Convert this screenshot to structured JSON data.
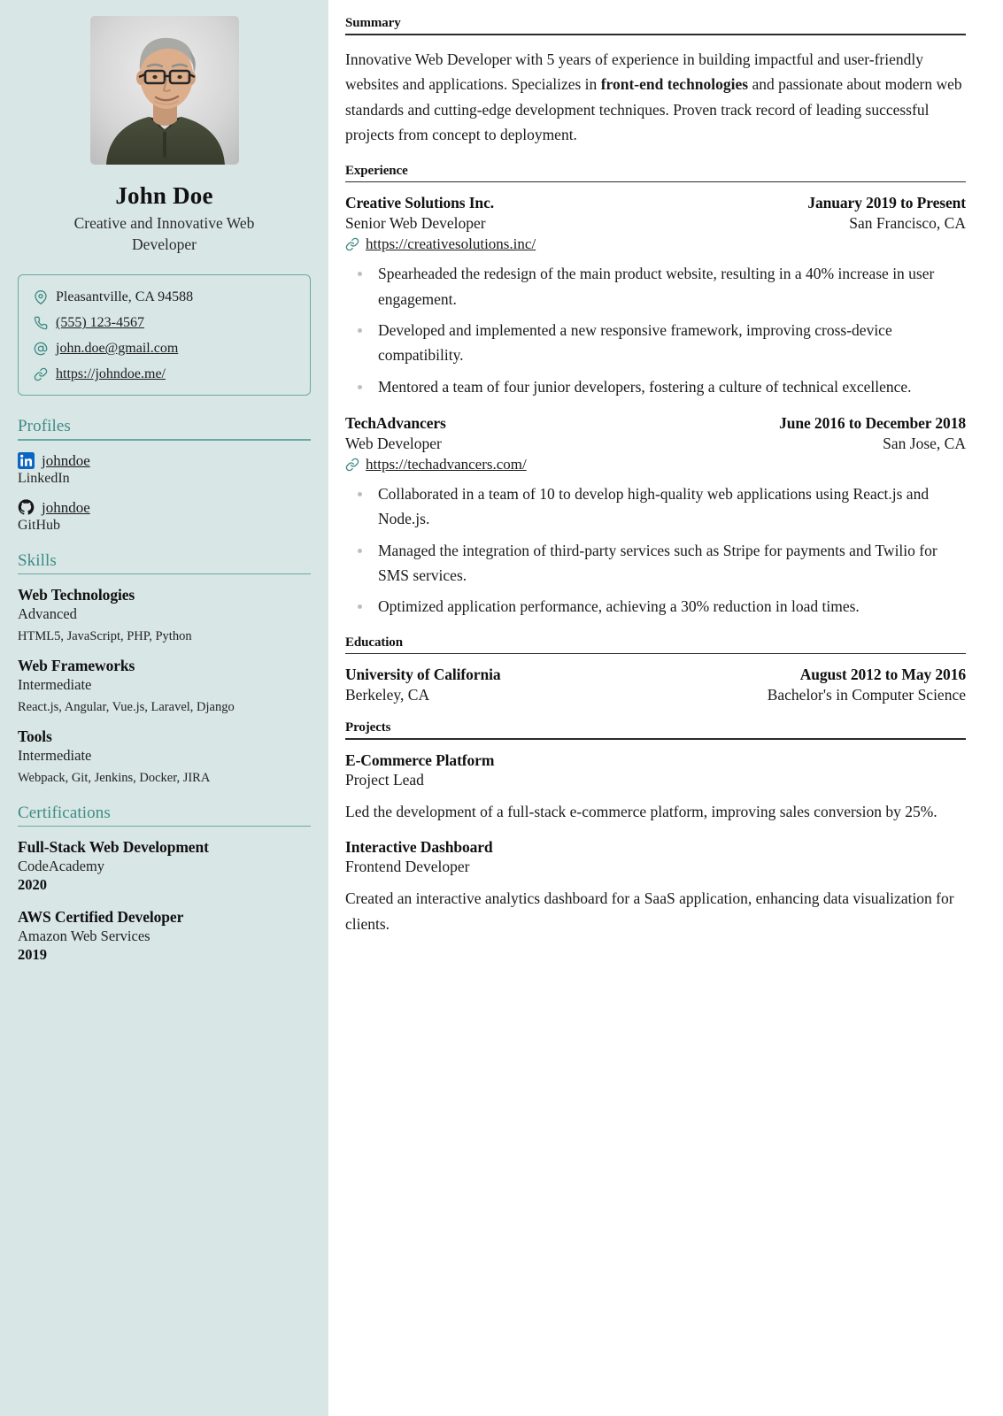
{
  "theme": {
    "sidebar_bg": "#d8e6e5",
    "accent_teal": "#3d8b85",
    "border_teal": "#6aa9a3",
    "linkedin_blue": "#0a66c2",
    "github_black": "#181717",
    "bullet_gray": "#b9bfc4",
    "text": "#1a1a1a"
  },
  "basics": {
    "name": "John Doe",
    "headline": "Creative and Innovative Web Developer",
    "photo_alt": "profile-photo"
  },
  "contact": [
    {
      "icon": "map-pin-icon",
      "label": "Pleasantville, CA 94588",
      "link": false
    },
    {
      "icon": "phone-icon",
      "label": "(555) 123-4567",
      "link": true
    },
    {
      "icon": "at-sign-icon",
      "label": "john.doe@gmail.com",
      "link": true
    },
    {
      "icon": "link-icon",
      "label": "https://johndoe.me/",
      "link": true
    }
  ],
  "sidebar": {
    "profiles": {
      "heading": "Profiles",
      "items": [
        {
          "icon": "linkedin-icon",
          "username": "johndoe",
          "network": "LinkedIn"
        },
        {
          "icon": "github-icon",
          "username": "johndoe",
          "network": "GitHub"
        }
      ]
    },
    "skills": {
      "heading": "Skills",
      "items": [
        {
          "name": "Web Technologies",
          "level": "Advanced",
          "keywords": "HTML5, JavaScript, PHP, Python"
        },
        {
          "name": "Web Frameworks",
          "level": "Intermediate",
          "keywords": "React.js, Angular, Vue.js, Laravel, Django"
        },
        {
          "name": "Tools",
          "level": "Intermediate",
          "keywords": "Webpack, Git, Jenkins, Docker, JIRA"
        }
      ]
    },
    "certifications": {
      "heading": "Certifications",
      "items": [
        {
          "name": "Full-Stack Web Development",
          "issuer": "CodeAcademy",
          "date": "2020"
        },
        {
          "name": "AWS Certified Developer",
          "issuer": "Amazon Web Services",
          "date": "2019"
        }
      ]
    }
  },
  "main": {
    "summary": {
      "heading": "Summary",
      "text_before": "Innovative Web Developer with 5 years of experience in building impactful and user-friendly websites and applications. Specializes in ",
      "text_bold": "front-end technologies",
      "text_after": " and passionate about modern web standards and cutting-edge development techniques. Proven track record of leading successful projects from concept to deployment."
    },
    "experience": {
      "heading": "Experience",
      "items": [
        {
          "organization": "Creative Solutions Inc.",
          "date": "January 2019 to Present",
          "position": "Senior Web Developer",
          "location": "San Francisco, CA",
          "url": "https://creativesolutions.inc/",
          "highlights": [
            "Spearheaded the redesign of the main product website, resulting in a 40% increase in user engagement.",
            "Developed and implemented a new responsive framework, improving cross-device compatibility.",
            "Mentored a team of four junior developers, fostering a culture of technical excellence."
          ]
        },
        {
          "organization": "TechAdvancers",
          "date": "June 2016 to December 2018",
          "position": "Web Developer",
          "location": "San Jose, CA",
          "url": "https://techadvancers.com/",
          "highlights": [
            "Collaborated in a team of 10 to develop high-quality web applications using React.js and Node.js.",
            "Managed the integration of third-party services such as Stripe for payments and Twilio for SMS services.",
            "Optimized application performance, achieving a 30% reduction in load times."
          ]
        }
      ]
    },
    "education": {
      "heading": "Education",
      "items": [
        {
          "institution": "University of California",
          "date": "August 2012 to May 2016",
          "location": "Berkeley, CA",
          "degree": "Bachelor's in Computer Science"
        }
      ]
    },
    "projects": {
      "heading": "Projects",
      "items": [
        {
          "name": "E-Commerce Platform",
          "role": "Project Lead",
          "description": "Led the development of a full-stack e-commerce platform, improving sales conversion by 25%."
        },
        {
          "name": "Interactive Dashboard",
          "role": "Frontend Developer",
          "description": "Created an interactive analytics dashboard for a SaaS application, enhancing data visualization for clients."
        }
      ]
    }
  }
}
